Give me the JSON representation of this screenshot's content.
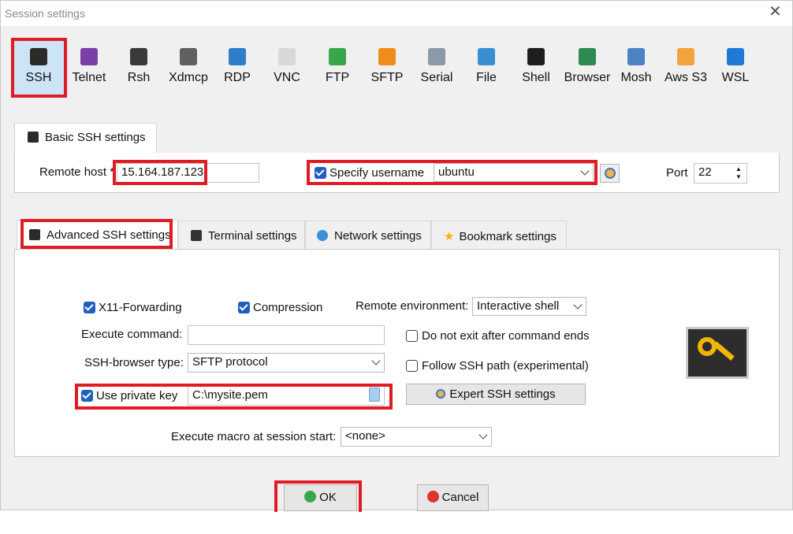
{
  "window": {
    "title": "Session settings"
  },
  "session_types": [
    {
      "label": "SSH",
      "icon": "ssh-key-icon",
      "color": "#2b2b2b"
    },
    {
      "label": "Telnet",
      "icon": "telnet-icon",
      "color": "#7b3fa8"
    },
    {
      "label": "Rsh",
      "icon": "rsh-icon",
      "color": "#3a3a3a"
    },
    {
      "label": "Xdmcp",
      "icon": "xdmcp-icon",
      "color": "#606060"
    },
    {
      "label": "RDP",
      "icon": "rdp-icon",
      "color": "#2f7fc8"
    },
    {
      "label": "VNC",
      "icon": "vnc-icon",
      "color": "#d8d8d8"
    },
    {
      "label": "FTP",
      "icon": "ftp-globe-icon",
      "color": "#3aa64a"
    },
    {
      "label": "SFTP",
      "icon": "sftp-globe-icon",
      "color": "#f08c1c"
    },
    {
      "label": "Serial",
      "icon": "serial-plug-icon",
      "color": "#8c9aa8"
    },
    {
      "label": "File",
      "icon": "file-monitor-icon",
      "color": "#3b8fd0"
    },
    {
      "label": "Shell",
      "icon": "shell-terminal-icon",
      "color": "#1e1e1e"
    },
    {
      "label": "Browser",
      "icon": "browser-globe-icon",
      "color": "#2f8a52"
    },
    {
      "label": "Mosh",
      "icon": "mosh-satellite-icon",
      "color": "#4a84c4"
    },
    {
      "label": "Aws S3",
      "icon": "aws-s3-icon",
      "color": "#f4a23c"
    },
    {
      "label": "WSL",
      "icon": "wsl-windows-icon",
      "color": "#2079d4"
    }
  ],
  "basic": {
    "tab_label": "Basic SSH settings",
    "remote_host_label": "Remote host *",
    "remote_host_value": "15.164.187.123",
    "specify_username_label": "Specify username",
    "username_value": "ubuntu",
    "port_label": "Port",
    "port_value": "22"
  },
  "tabs": {
    "advanced": "Advanced SSH settings",
    "terminal": "Terminal settings",
    "network": "Network settings",
    "bookmark": "Bookmark settings"
  },
  "advanced": {
    "x11_label": "X11-Forwarding",
    "compression_label": "Compression",
    "remote_env_label": "Remote environment:",
    "remote_env_value": "Interactive shell",
    "execute_command_label": "Execute command:",
    "execute_command_value": "",
    "do_not_exit_label": "Do not exit after command ends",
    "ssh_browser_label": "SSH-browser type:",
    "ssh_browser_value": "SFTP protocol",
    "follow_ssh_label": "Follow SSH path (experimental)",
    "use_private_key_label": "Use private key",
    "private_key_value": "C:\\mysite.pem",
    "expert_button": "Expert SSH settings",
    "macro_label": "Execute macro at session start:",
    "macro_value": "<none>"
  },
  "footer": {
    "ok": "OK",
    "cancel": "Cancel"
  },
  "colors": {
    "highlight": "#e01b24",
    "checkbox": "#1f5fbf",
    "selected": "#cde4f7"
  }
}
